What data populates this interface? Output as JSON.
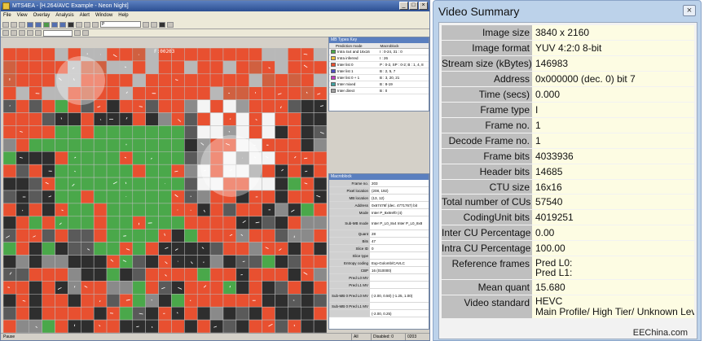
{
  "app": {
    "title": "MTS4EA - [H.264/AVC Example - Neon Night]",
    "menu": [
      "File",
      "View",
      "Overlay",
      "Analysis",
      "Alert",
      "Window",
      "Help"
    ],
    "frame_select": "P",
    "frame_label": "F:00203"
  },
  "mb_types_panel": {
    "title": "MB Types Key",
    "headers": [
      "Prediction mode",
      "Macroblock"
    ],
    "rows": [
      {
        "name": "Intra 4x4 and 16x16",
        "value": "I : 0-24, 31 : 0",
        "color": "#4aa84a"
      },
      {
        "name": "Intra inferred",
        "value": "I : 26",
        "color": "#e8c040"
      },
      {
        "name": "Inter list 0",
        "value": "P : 0-2, SP : 0-2; B : 1, 4, 8",
        "color": "#e85030"
      },
      {
        "name": "Inter list 1",
        "value": "B : 2, 5, 7",
        "color": "#5050c0"
      },
      {
        "name": "Inter list 0 + 1",
        "value": "B : 3, 20, 21",
        "color": "#c040c0"
      },
      {
        "name": "Inter mixed",
        "value": "B : 8-19",
        "color": "#40a0a0"
      },
      {
        "name": "Inter direct",
        "value": "B : 0",
        "color": "#a0a0a0"
      }
    ]
  },
  "macroblock_panel": {
    "title": "Macroblock",
    "rows": [
      {
        "k": "Frame no.",
        "v": "203"
      },
      {
        "k": "Pixel location",
        "v": "(208, 192)"
      },
      {
        "k": "MB location",
        "v": "(13, 12)"
      },
      {
        "k": "Address",
        "v": "0x67476f (dec. 4771767) bit"
      },
      {
        "k": "Mode",
        "v": "Inter P_8x8ref0 (4)"
      },
      {
        "k": "Sub-MB mode",
        "v": "Inter P_L0_8x4   Inter P_L0_8x8"
      },
      {
        "k": "Quant",
        "v": "28"
      },
      {
        "k": "Bits",
        "v": "47"
      },
      {
        "k": "Slice ID",
        "v": "0"
      },
      {
        "k": "Slice type",
        "v": ""
      },
      {
        "k": "Entropy coding",
        "v": "Exp-Golomb/CAVLC"
      },
      {
        "k": "CBP",
        "v": "16 (010000)"
      },
      {
        "k": "Pred L0 MV",
        "v": ""
      },
      {
        "k": "Pred L1 MV",
        "v": ""
      },
      {
        "k": "Sub-MB 0 Pred L0 MV",
        "v": "(-2.00, 0.50) (-1.25, 1.00)"
      },
      {
        "k": "Sub-MB 0 Pred L1 MV",
        "v": ""
      },
      {
        "k": "",
        "v": "(-2.00, 0.25)"
      }
    ]
  },
  "statusbar": {
    "text": "Pause",
    "seg1": "All",
    "seg2": "Disabled: 0",
    "seg3": "0203"
  },
  "summary": {
    "title": "Video Summary",
    "close": "×",
    "rows": [
      {
        "label": "Image size",
        "value": "3840 x 2160"
      },
      {
        "label": "Image format",
        "value": "YUV 4:2:0 8-bit"
      },
      {
        "label": "Stream size (kBytes)",
        "value": "146983"
      },
      {
        "label": "Address",
        "value": "0x000000 (dec. 0) bit 7"
      },
      {
        "label": "Time (secs)",
        "value": "0.000"
      },
      {
        "label": "Frame type",
        "value": "I"
      },
      {
        "label": "Frame no.",
        "value": "1"
      },
      {
        "label": "Decode Frame no.",
        "value": "1"
      },
      {
        "label": "Frame bits",
        "value": "4033936"
      },
      {
        "label": "Header bits",
        "value": "14685"
      },
      {
        "label": "CTU size",
        "value": "16x16"
      },
      {
        "label": "Total number of CUs",
        "value": "57540"
      },
      {
        "label": "CodingUnit bits",
        "value": "4019251"
      },
      {
        "label": "Inter CU Percentage",
        "value": "0.00"
      },
      {
        "label": "Intra CU Percentage",
        "value": "100.00"
      },
      {
        "label": "Reference frames",
        "value": "Pred L0:",
        "value2": "Pred L1:"
      },
      {
        "label": "Mean quant",
        "value": "15.680"
      },
      {
        "label": "Video standard",
        "value": "HEVC",
        "value2": "Main Profile/ High Tier/ Unknown Level"
      }
    ]
  },
  "watermark": "EEChina.com"
}
